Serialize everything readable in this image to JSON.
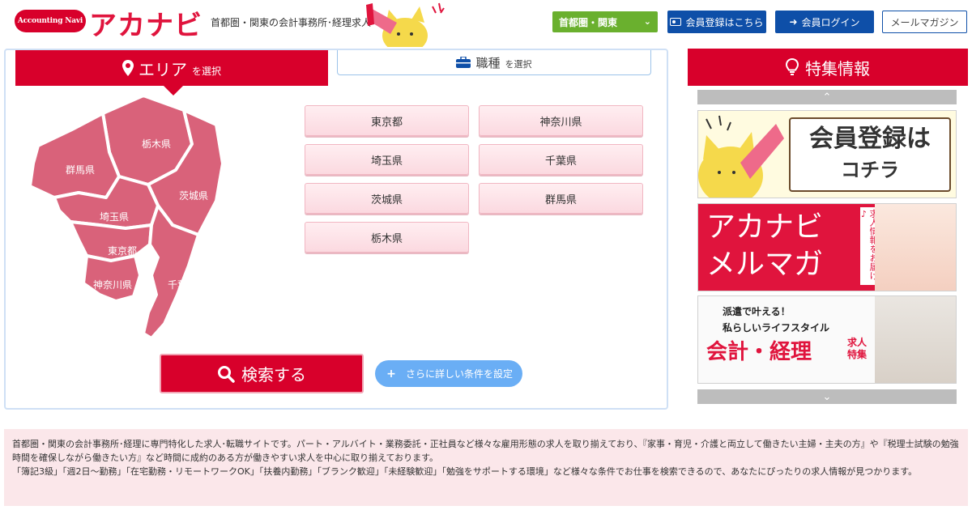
{
  "header": {
    "logo_pill": "Accounting Navi",
    "logo_text": "アカナビ",
    "tagline": "首都圏・関東の会計事務所･経理求人",
    "region_select": "首都圏・関東",
    "register_button": "会員登録はこちら",
    "login_button": "会員ログイン",
    "magazine_button": "メールマガジン"
  },
  "search": {
    "tab_area_big": "エリア",
    "tab_area_small": "を選択",
    "tab_job_big": "職種",
    "tab_job_small": "を選択",
    "prefectures": [
      "東京都",
      "神奈川県",
      "埼玉県",
      "千葉県",
      "茨城県",
      "群馬県",
      "栃木県"
    ],
    "map_labels": {
      "tochigi": "栃木県",
      "gunma": "群馬県",
      "ibaraki": "茨城県",
      "saitama": "埼玉県",
      "tokyo": "東京都",
      "kanagawa": "神奈川県",
      "chiba": "千葉県"
    },
    "search_button": "検索する",
    "detail_button": "さらに詳しい条件を設定"
  },
  "feature": {
    "title": "特集情報",
    "banner1": {
      "line1": "会員登録は",
      "line2": "コチラ"
    },
    "banner2": {
      "line1": "アカナビ",
      "line2": "メルマガ",
      "sub": "求人情報をお届け♪"
    },
    "banner3": {
      "line1": "派遣で叶える！",
      "line2": "私らしいライフスタイル",
      "line3": "会計・経理",
      "line4": "求人特集"
    }
  },
  "description": {
    "p1": "首都圏・関東の会計事務所･経理に専門特化した求人･転職サイトです。パート・アルバイト・業務委託・正社員など様々な雇用形態の求人を取り揃えており、『家事・育児・介護と両立して働きたい主婦・主夫の方』や『税理士試験の勉強時間を確保しながら働きたい方』など時間に成約のある方が働きやすい求人を中心に取り揃えております。",
    "p2": "「簿記3級」「週2日～勤務」「在宅勤務・リモートワークOK」「扶養内勤務」「ブランク歓迎」「未経験歓迎」「勉強をサポートする環境」など様々な条件でお仕事を検索できるので、あなたにぴったりの求人情報が見つかります。"
  },
  "colors": {
    "brand": "#d8002b",
    "navy": "#0e4fa8",
    "green": "#6ab02e",
    "map": "#d9627a"
  }
}
